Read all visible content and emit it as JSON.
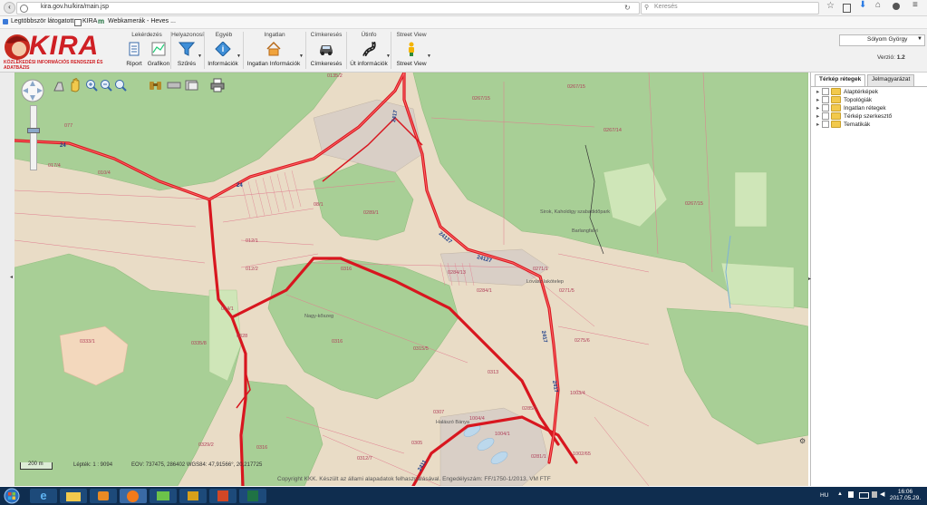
{
  "browser": {
    "url": "kira.gov.hu/kira/main.jsp",
    "search_placeholder": "Keresés",
    "bookmarks": [
      "Legtöbbször látogatott",
      "KIRA",
      "Webkamerák - Heves ..."
    ]
  },
  "logo": {
    "text": "KIRA",
    "subtitle": "KÖZLEKEDÉSI INFORMÁCIÓS RENDSZER ÉS ADATBÁZIS"
  },
  "toolbar": {
    "groups": [
      {
        "title": "Lekérdezés",
        "buttons": [
          "Riport",
          "Grafikon"
        ]
      },
      {
        "title": "Helyazonosí",
        "buttons": [
          "Szűrés"
        ]
      },
      {
        "title": "Egyéb",
        "buttons": [
          "Információk"
        ]
      },
      {
        "title": "Ingatlan",
        "buttons": [
          "Ingatlan Információk"
        ]
      },
      {
        "title": "Címkeresés",
        "buttons": [
          "Címkeresés"
        ]
      },
      {
        "title": "Útinfo",
        "buttons": [
          "Út információk"
        ]
      },
      {
        "title": "Street View",
        "buttons": [
          "Street View"
        ]
      }
    ]
  },
  "user": {
    "name": "Sólyom György"
  },
  "version": {
    "label": "Verzió:",
    "value": "1.2"
  },
  "map": {
    "scale_label": "200 m",
    "scale_text": "Lépték: 1 : 9094",
    "coords_text": "EOV: 737475, 286402     WGS84: 47,91566°, 20,217725",
    "copyright": "Copyright KKK. Készült az állami alapadatok felhasználásával. Engedélyszám: FF/1750-1/2013. VM FTF",
    "labels": [
      "0267/15",
      "0267/14",
      "0267/15",
      "0271/1",
      "0275/6",
      "0313",
      "0316",
      "0333/1",
      "0335/8",
      "012/1",
      "012/2",
      "0316",
      "0284/1",
      "0284/13",
      "0315/5",
      "1004/1",
      "1004/4",
      "1002/65",
      "0329/2",
      "0316",
      "0312/7",
      "0305",
      "0281/1",
      "0307",
      "0285/1",
      "0289/1",
      "017/4",
      "010/4",
      "077",
      "0135/2",
      "0267/15",
      "08/1",
      "0271/5",
      "024/1",
      "0328",
      "1003/4"
    ],
    "road_labels": [
      "24",
      "24",
      "2417",
      "24127",
      "24127",
      "2417",
      "2417",
      "2411"
    ],
    "place_labels": [
      "Sirok, Kaholdigy szabadidőpark",
      "Barlangfalvi",
      "Lovász lakótelep",
      "Halászó Bánya",
      "Nagy-kőszeg"
    ]
  },
  "panel": {
    "tabs": [
      "Térkép rétegek",
      "Jelmagyarázat"
    ],
    "tree": [
      "Alaptérképek",
      "Topológiák",
      "Ingatlan rétegek",
      "Térkép szerkesztő",
      "Tematikák"
    ]
  },
  "taskbar": {
    "lang": "HU",
    "time": "16:06",
    "date": "2017.05.29."
  }
}
